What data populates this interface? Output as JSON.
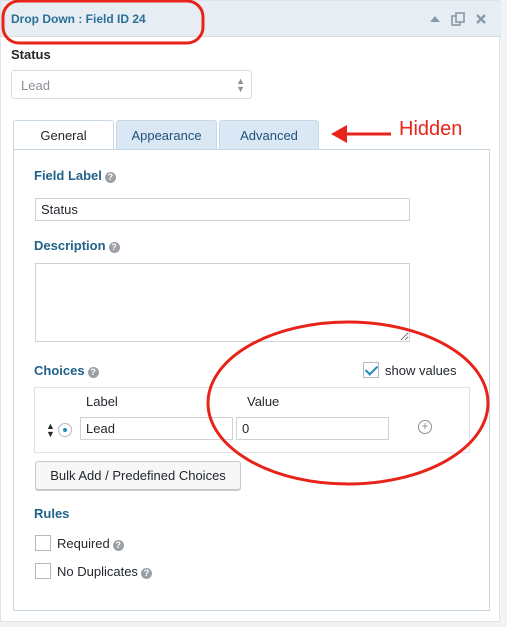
{
  "header": {
    "title": "Drop Down : Field ID 24",
    "icons": [
      "collapse-up-icon",
      "duplicate-icon",
      "delete-icon"
    ]
  },
  "status": {
    "label": "Status",
    "selected": "Lead"
  },
  "tabs": [
    {
      "label": "General",
      "active": true
    },
    {
      "label": "Appearance",
      "active": false
    },
    {
      "label": "Advanced",
      "active": false
    }
  ],
  "annotation": {
    "hidden_label": "Hidden",
    "color": "#e8241a"
  },
  "general": {
    "field_label": {
      "label": "Field Label",
      "value": "Status"
    },
    "description": {
      "label": "Description",
      "value": ""
    },
    "choices": {
      "label": "Choices",
      "show_values_label": "show values",
      "show_values_checked": true,
      "columns": {
        "label": "Label",
        "value": "Value"
      },
      "rows": [
        {
          "label": "Lead",
          "value": "0"
        }
      ]
    },
    "bulk_add_label": "Bulk Add / Predefined Choices",
    "rules": {
      "label": "Rules",
      "items": [
        {
          "label": "Required",
          "checked": false
        },
        {
          "label": "No Duplicates",
          "checked": false
        }
      ]
    }
  },
  "colors": {
    "accent": "#21628a",
    "header_bg": "#e6eef4",
    "tab_bg": "#d9e8f4"
  }
}
